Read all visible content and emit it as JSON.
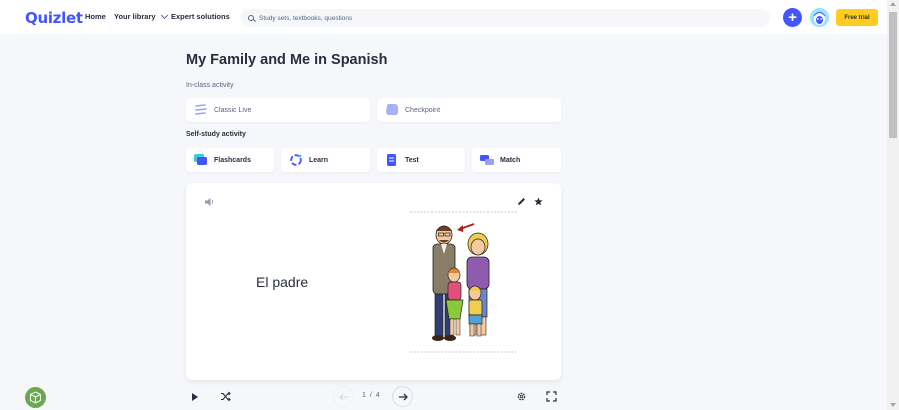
{
  "nav": {
    "logo": "Quizlet",
    "home": "Home",
    "library": "Your library",
    "expert": "Expert solutions",
    "search_placeholder": "Study sets, textbooks, questions",
    "plus_label": "+",
    "free_trial": "Free trial"
  },
  "set": {
    "title": "My Family and Me in Spanish"
  },
  "in_class": {
    "label": "In-class activity",
    "modes": [
      {
        "label": "Classic Live"
      },
      {
        "label": "Checkpoint"
      }
    ]
  },
  "self_study": {
    "label": "Self-study activity",
    "modes": [
      {
        "label": "Flashcards"
      },
      {
        "label": "Learn"
      },
      {
        "label": "Test"
      },
      {
        "label": "Match"
      }
    ]
  },
  "flashcard": {
    "term": "El padre",
    "has_image": true
  },
  "controls": {
    "counter": "1 / 4"
  },
  "colors": {
    "brand": "#4255ff",
    "free_trial": "#ffcd1f",
    "background": "#f6f7fb",
    "text": "#282e3e",
    "muted_text": "#586380"
  },
  "icons": [
    "search-icon",
    "chevron-down-icon",
    "plus-icon",
    "avatar-icon",
    "speaker-icon",
    "pencil-icon",
    "star-icon",
    "play-icon",
    "shuffle-icon",
    "arrow-left-icon",
    "arrow-right-icon",
    "gear-icon",
    "fullscreen-icon"
  ]
}
